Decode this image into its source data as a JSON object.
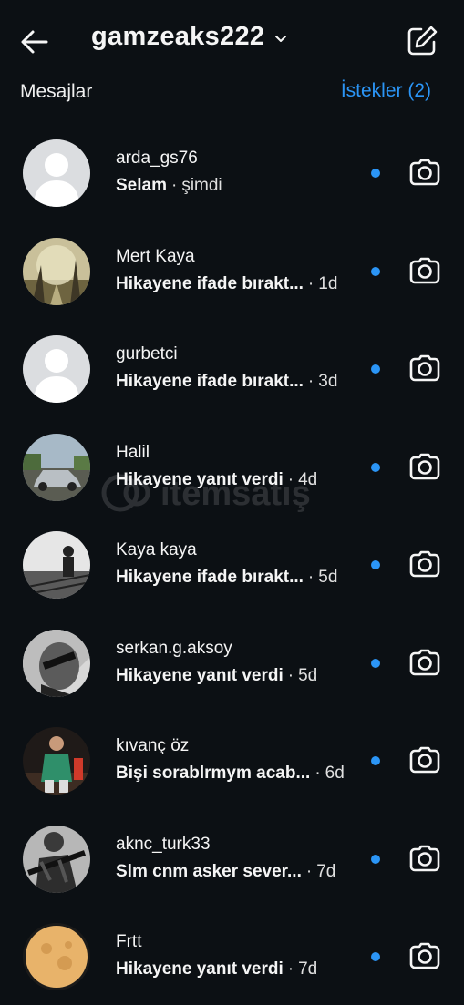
{
  "header": {
    "username": "gamzeaks222"
  },
  "section": {
    "messages_label": "Mesajlar",
    "requests_label": "İstekler (2)"
  },
  "conversations": [
    {
      "name": "arda_gs76",
      "preview": "Selam",
      "time": "şimdi",
      "unread": true,
      "avatar": "default-avatar"
    },
    {
      "name": "Mert Kaya",
      "preview": "Hikayene ifade bırakt...",
      "time": "1d",
      "unread": true,
      "avatar": "forest-photo"
    },
    {
      "name": "gurbetci",
      "preview": "Hikayene ifade bırakt...",
      "time": "3d",
      "unread": true,
      "avatar": "default-avatar"
    },
    {
      "name": "Halil",
      "preview": "Hikayene yanıt verdi",
      "time": "4d",
      "unread": true,
      "avatar": "car-photo"
    },
    {
      "name": "Kaya kaya",
      "preview": "Hikayene ifade bırakt...",
      "time": "5d",
      "unread": true,
      "avatar": "railway-photo"
    },
    {
      "name": "serkan.g.aksoy",
      "preview": "Hikayene yanıt verdi",
      "time": "5d",
      "unread": true,
      "avatar": "bw-portrait"
    },
    {
      "name": "kıvanç öz",
      "preview": "Bişi sorablrmym acab...",
      "time": "6d",
      "unread": true,
      "avatar": "football-player"
    },
    {
      "name": "aknc_turk33",
      "preview": "Slm cnm asker sever...",
      "time": "7d",
      "unread": true,
      "avatar": "soldier-photo"
    },
    {
      "name": "Frtt",
      "preview": "Hikayene yanıt verdi",
      "time": "7d",
      "unread": true,
      "avatar": "moon-photo"
    }
  ],
  "watermark": {
    "text": "itemsatış"
  },
  "colors": {
    "background": "#0c1014",
    "accent": "#2b95f6",
    "text": "#f5f5f5"
  }
}
